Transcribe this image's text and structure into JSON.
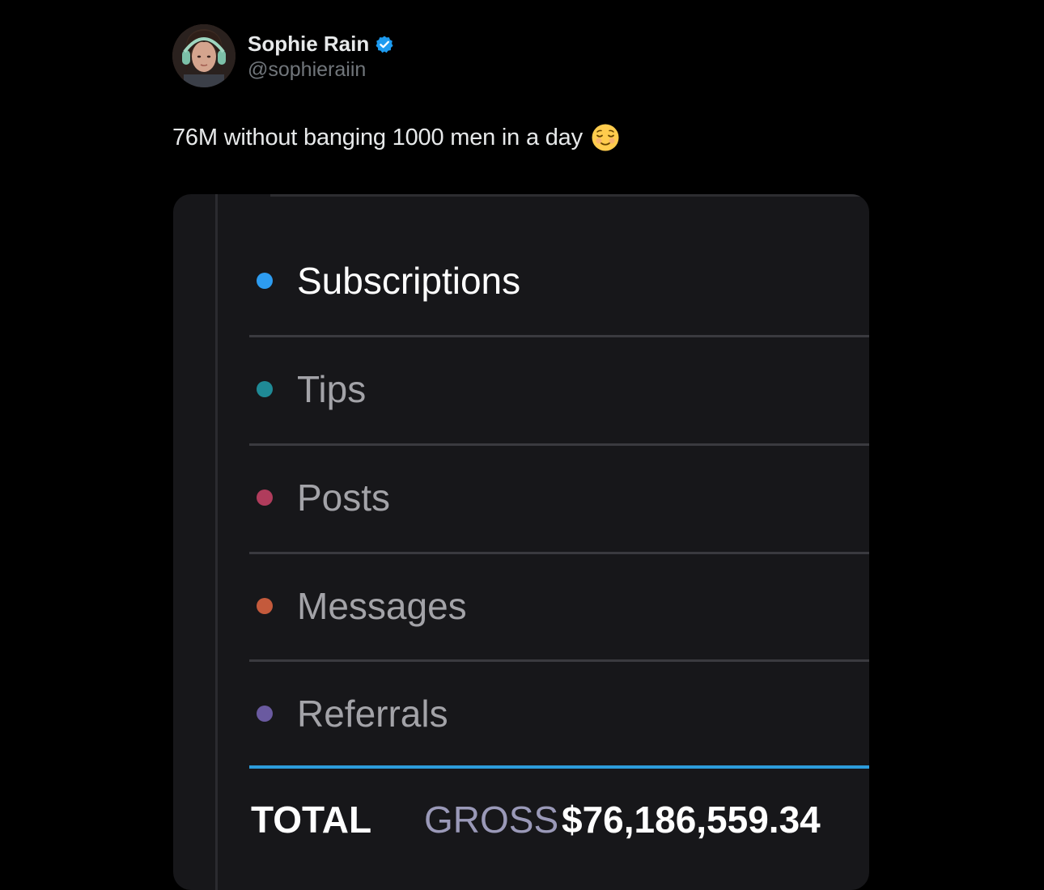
{
  "author": {
    "display_name": "Sophie Rain",
    "handle": "@sophieraiin",
    "verified": true,
    "verified_icon": "verified-badge-icon",
    "verified_color": "#1d9bf0"
  },
  "tweet": {
    "text": "76M without banging 1000 men in a day",
    "emoji": "relieved-face-emoji"
  },
  "earnings_card": {
    "categories": [
      {
        "label": "Subscriptions",
        "dot_color": "#2d9cf0",
        "text_color": "#ffffff"
      },
      {
        "label": "Tips",
        "dot_color": "#1f8a96",
        "text_color": "#a3a3a8"
      },
      {
        "label": "Posts",
        "dot_color": "#b03c5c",
        "text_color": "#a3a3a8"
      },
      {
        "label": "Messages",
        "dot_color": "#c45a3c",
        "text_color": "#a3a3a8"
      },
      {
        "label": "Referrals",
        "dot_color": "#6a5aa0",
        "text_color": "#a3a3a8"
      }
    ],
    "total_label": "TOTAL",
    "gross_label": "GROSS",
    "total_amount": "$76,186,559.34",
    "accent_color": "#2d9cdb"
  }
}
